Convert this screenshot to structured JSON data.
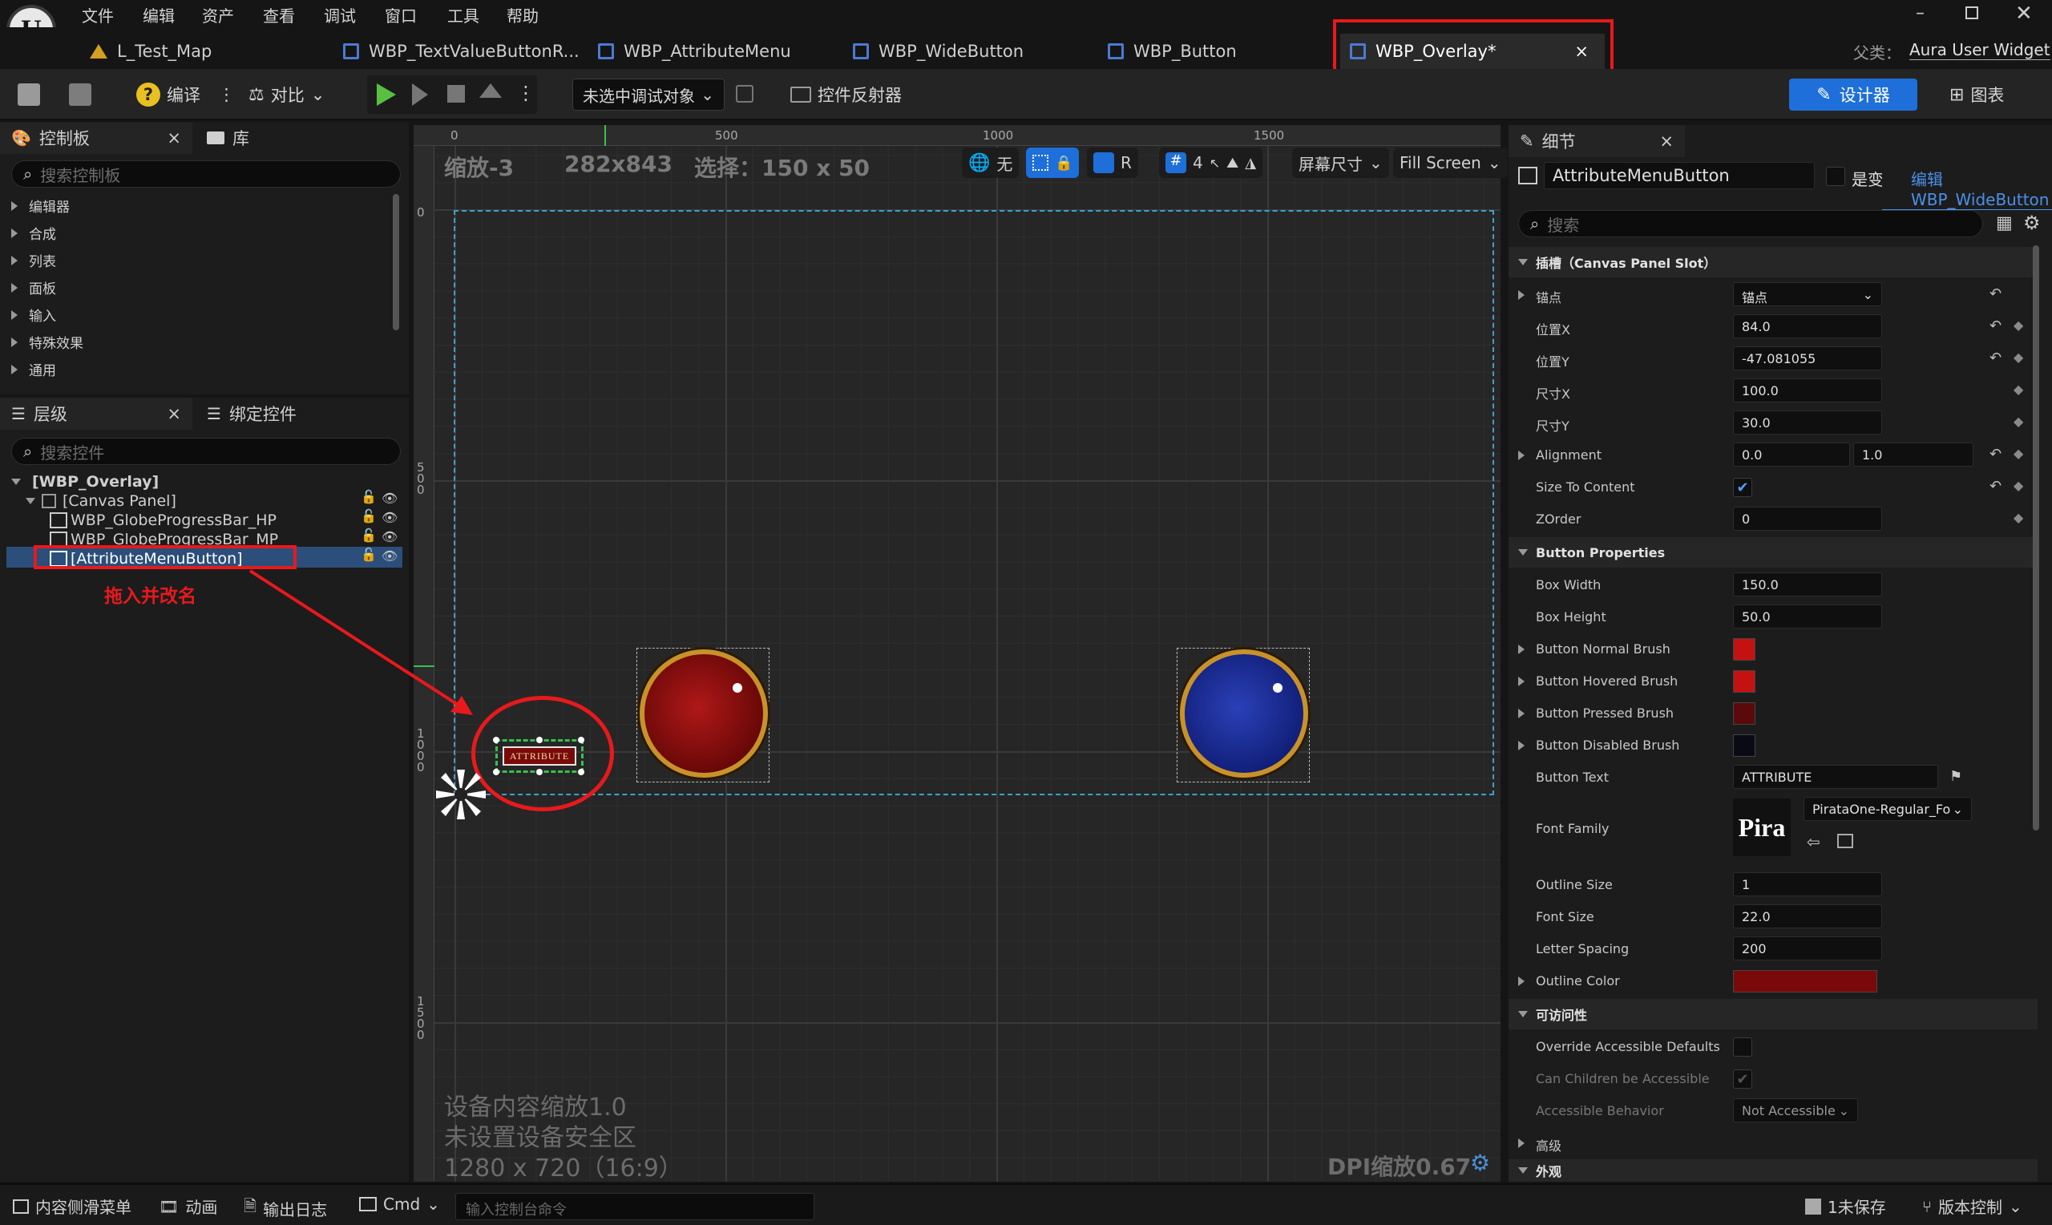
{
  "menu": [
    "文件",
    "编辑",
    "资产",
    "查看",
    "调试",
    "窗口",
    "工具",
    "帮助"
  ],
  "tabs": [
    {
      "label": "L_Test_Map"
    },
    {
      "label": "WBP_TextValueButtonR..."
    },
    {
      "label": "WBP_AttributeMenu"
    },
    {
      "label": "WBP_WideButton"
    },
    {
      "label": "WBP_Button"
    },
    {
      "label": "WBP_Overlay*",
      "close": "×"
    }
  ],
  "parent": {
    "label": "父类：",
    "value": "Aura User Widget"
  },
  "toolbar": {
    "compile": "编译",
    "diff": "对比",
    "debug_target": "未选中调试对象",
    "reflector": "控件反射器",
    "designer": "设计器",
    "graph": "图表"
  },
  "palette": {
    "tab_palette": "控制板",
    "tab_library": "库",
    "close": "×",
    "search_placeholder": "搜索控制板",
    "categories": [
      "编辑器",
      "合成",
      "列表",
      "面板",
      "输入",
      "特殊效果",
      "通用"
    ]
  },
  "hierarchy": {
    "tab_hierarchy": "层级",
    "tab_bind": "绑定控件",
    "close": "×",
    "search_placeholder": "搜索控件",
    "root": "[WBP_Overlay]",
    "canvas": "[Canvas Panel]",
    "items": [
      "WBP_GlobeProgressBar_HP",
      "WBP_GlobeProgressBar_MP",
      "[AttributeMenuButton]"
    ],
    "annotation": "拖入并改名"
  },
  "viewport": {
    "zoom": "缩放-3",
    "size": "282x843",
    "selection": "选择：150 x 50",
    "ruler_top": [
      "0",
      "500",
      "1000",
      "1500"
    ],
    "ruler_left": [
      "0",
      "5 0 0",
      "1 0 0 0",
      "1 5 0 0"
    ],
    "btn_none": "无",
    "btn_r": "R",
    "grid_count": "4",
    "screen_size": "屏幕尺寸",
    "fill_screen": "Fill Screen",
    "button_text": "ATTRIBUTE",
    "footer_line1": "设备内容缩放1.0",
    "footer_line2": "未设置设备安全区",
    "footer_line3": "1280 x 720（16:9）",
    "dpi": "DPI缩放0.67"
  },
  "details": {
    "tab": "细节",
    "close": "×",
    "widget_name": "AttributeMenuButton",
    "is_variable": "是变量",
    "edit_link": "编辑WBP_WideButton",
    "search_placeholder": "搜索",
    "slot_section": "插槽（Canvas Panel Slot）",
    "anchor_label": "锚点",
    "anchor_value": "锚点",
    "posx_label": "位置X",
    "posx_value": "84.0",
    "posy_label": "位置Y",
    "posy_value": "-47.081055",
    "sizex_label": "尺寸X",
    "sizex_value": "100.0",
    "sizey_label": "尺寸Y",
    "sizey_value": "30.0",
    "alignment_label": "Alignment",
    "alignment_x": "0.0",
    "alignment_y": "1.0",
    "stc_label": "Size To Content",
    "zorder_label": "ZOrder",
    "zorder_value": "0",
    "btn_section": "Button Properties",
    "box_width_label": "Box Width",
    "box_width_value": "150.0",
    "box_height_label": "Box Height",
    "box_height_value": "50.0",
    "normal_brush_label": "Button Normal Brush",
    "hovered_brush_label": "Button Hovered Brush",
    "pressed_brush_label": "Button Pressed Brush",
    "disabled_brush_label": "Button Disabled Brush",
    "button_text_label": "Button Text",
    "button_text_value": "ATTRIBUTE",
    "font_family_label": "Font Family",
    "font_family_value": "PirataOne-Regular_Fo",
    "font_preview": "Pira",
    "outline_size_label": "Outline Size",
    "outline_size_value": "1",
    "font_size_label": "Font Size",
    "font_size_value": "22.0",
    "letter_spacing_label": "Letter Spacing",
    "letter_spacing_value": "200",
    "outline_color_label": "Outline Color",
    "access_section": "可访问性",
    "override_label": "Override Accessible Defaults",
    "children_label": "Can Children be Accessible",
    "behavior_label": "Accessible Behavior",
    "behavior_value": "Not Accessible",
    "advanced": "高级",
    "appearance": "外观"
  },
  "colors": {
    "normal_brush": "#c41212",
    "hovered_brush": "#c41212",
    "pressed_brush": "#5a0a0a",
    "disabled_brush": "#0a0a14",
    "outline_color": "#7a0a0a",
    "accent": "#1e6fd9",
    "annotation": "#e8191c"
  },
  "statusbar": {
    "drawer": "内容侧滑菜单",
    "anim": "动画",
    "log": "输出日志",
    "cmd": "Cmd",
    "console_placeholder": "输入控制台命令",
    "unsaved": "1未保存",
    "vcs": "版本控制"
  }
}
